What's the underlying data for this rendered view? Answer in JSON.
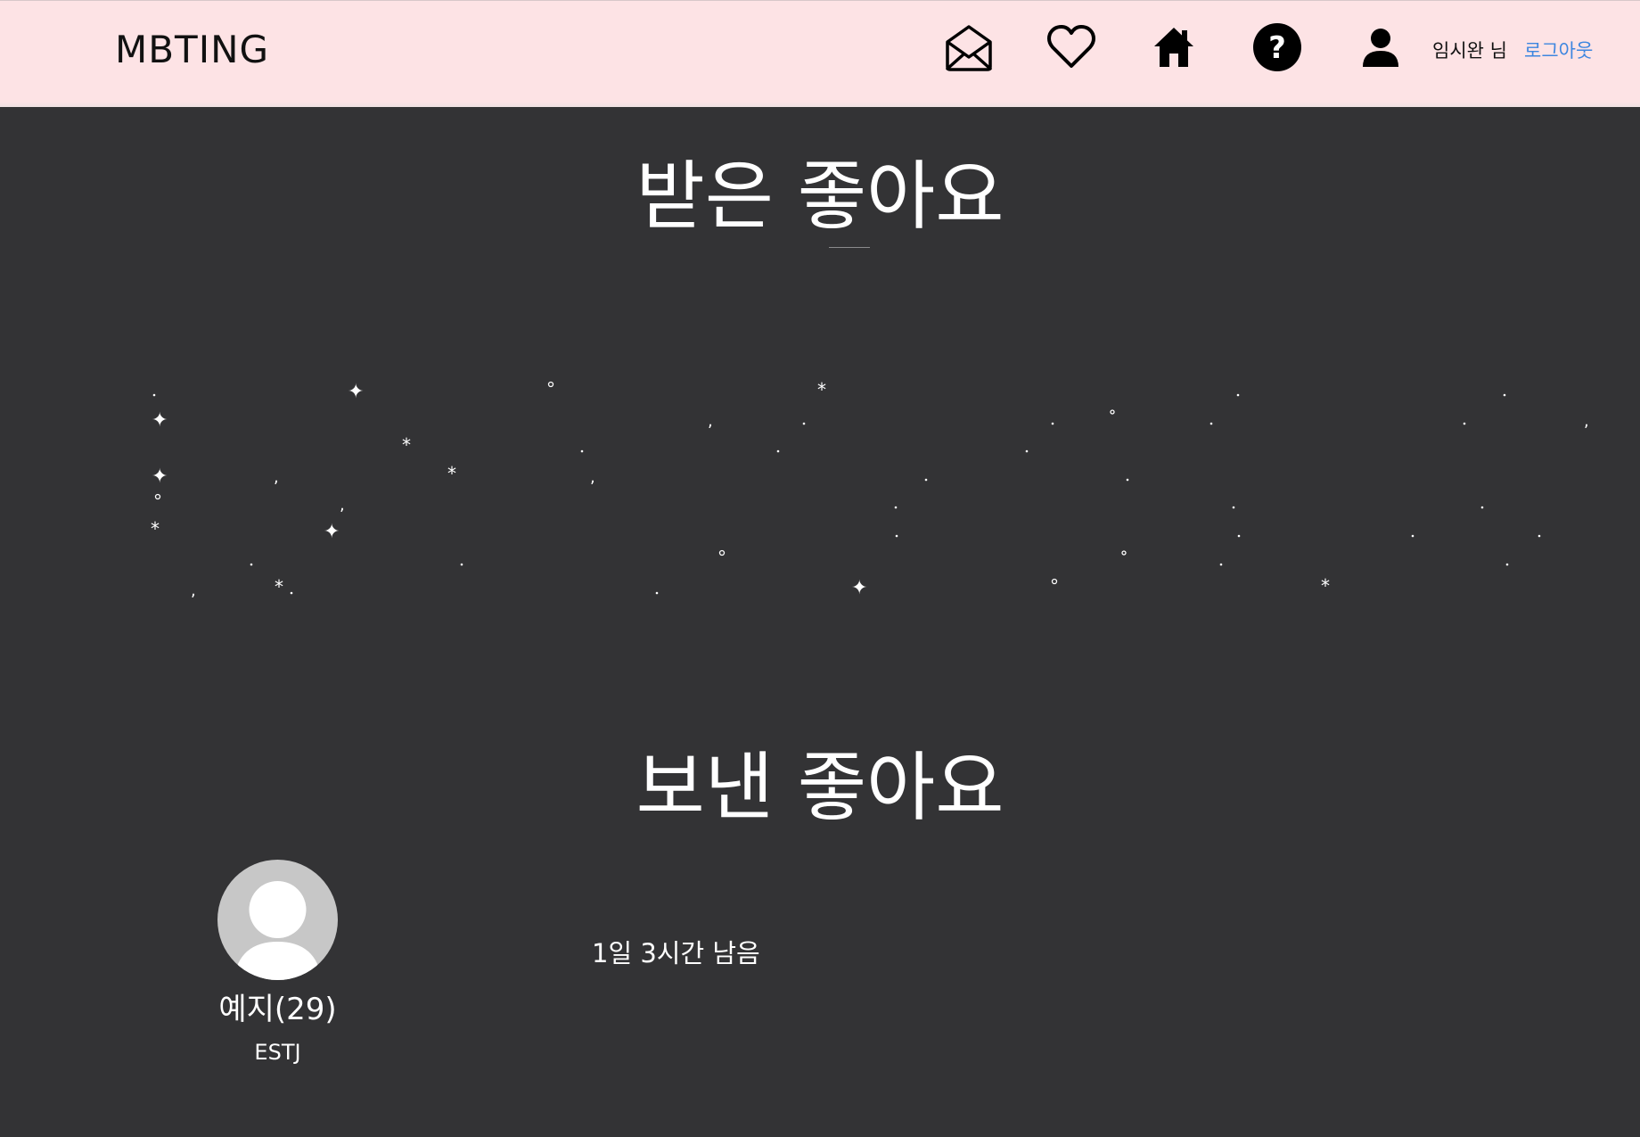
{
  "header": {
    "logo": "MBTING",
    "icons": [
      "mail-open-icon",
      "heart-icon",
      "home-icon",
      "help-icon",
      "user-icon"
    ],
    "user_name": "임시완 님",
    "logout_label": "로그아웃"
  },
  "received": {
    "title": "받은 좋아요"
  },
  "sent": {
    "title": "보낸 좋아요",
    "cards": [
      {
        "name": "예지(29)",
        "mbti": "ESTJ",
        "remaining": "1일 3시간 남음"
      }
    ]
  },
  "colors": {
    "header_bg": "#fde3e5",
    "page_bg": "#333335",
    "logout": "#3d86e0",
    "avatar_bg": "#c7c7c7"
  }
}
